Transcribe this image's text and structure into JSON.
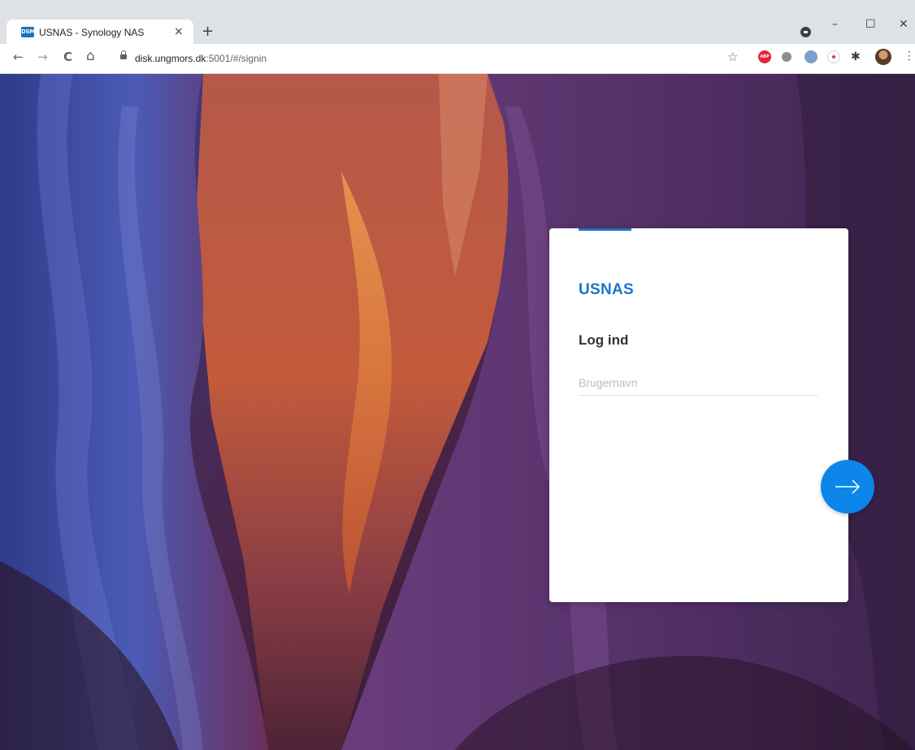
{
  "browser": {
    "tab_title": "USNAS - Synology NAS",
    "tab_favicon_text": "DSM",
    "tab_close": "×",
    "new_tab": "+",
    "url_host": "disk.ungmors.dk",
    "url_path": ":5001/#/signin",
    "window_minimize": "–",
    "window_maximize": "☐",
    "window_close": "✕",
    "nav_back": "←",
    "nav_forward": "→",
    "nav_reload": "C",
    "nav_home": "⌂",
    "star": "☆",
    "ext_abp": "ABP",
    "puzzle": "✱",
    "menu": "⋮"
  },
  "login": {
    "brand": "USNAS",
    "heading": "Log ind",
    "username_placeholder": "Brugernavn",
    "username_value": ""
  },
  "icons": {
    "next": "arrow-right-icon"
  },
  "colors": {
    "accent": "#1e74c8",
    "next_button": "#0c86e8",
    "placeholder": "#b8bcc1"
  }
}
